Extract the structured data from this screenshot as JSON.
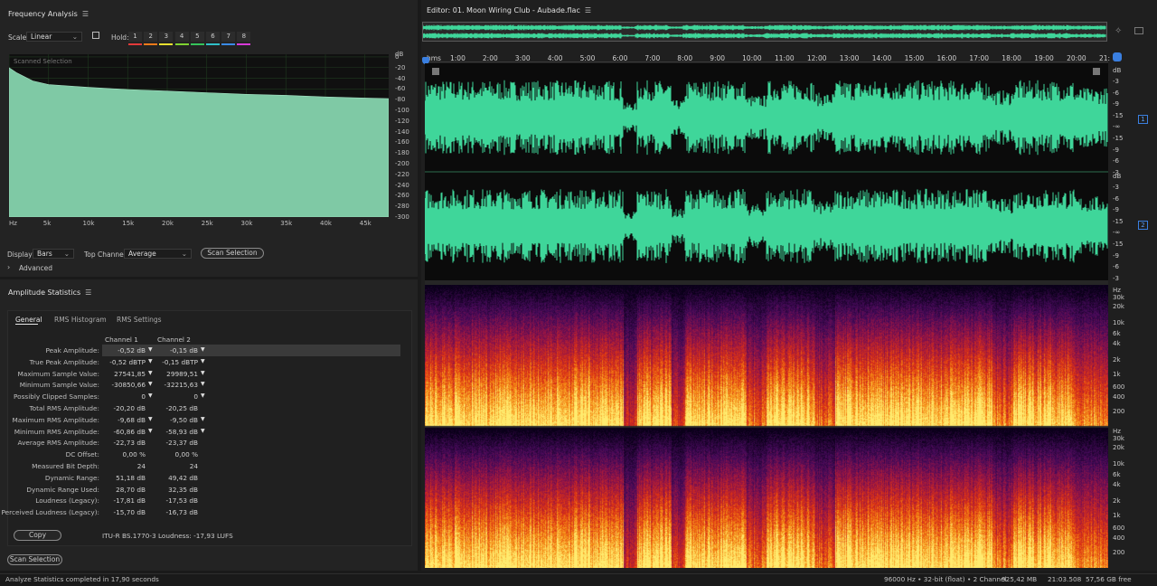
{
  "freq_panel": {
    "title": "Frequency Analysis",
    "scale_label": "Scale:",
    "scale_value": "Linear",
    "hold_label": "Hold:",
    "hold_buttons": [
      {
        "label": "1",
        "color": "#e23a3a"
      },
      {
        "label": "2",
        "color": "#f07a1a"
      },
      {
        "label": "3",
        "color": "#e8e030"
      },
      {
        "label": "4",
        "color": "#7fd431"
      },
      {
        "label": "5",
        "color": "#35c35a"
      },
      {
        "label": "6",
        "color": "#30c0c8"
      },
      {
        "label": "7",
        "color": "#3a8ae6"
      },
      {
        "label": "8",
        "color": "#d83ad8"
      }
    ],
    "graph_caption": "Scanned Selection",
    "y_unit": "dB",
    "y_ticks": [
      "0",
      "-20",
      "-40",
      "-60",
      "-80",
      "-100",
      "-120",
      "-140",
      "-160",
      "-180",
      "-200",
      "-220",
      "-240",
      "-260",
      "-280",
      "-300"
    ],
    "x_ticks": [
      "Hz",
      "5k",
      "10k",
      "15k",
      "20k",
      "25k",
      "30k",
      "35k",
      "40k",
      "45k"
    ],
    "display_label": "Display:",
    "display_value": "Bars",
    "top_channel_label": "Top Channel:",
    "top_channel_value": "Average",
    "scan_button": "Scan Selection",
    "advanced_label": "Advanced"
  },
  "chart_data": {
    "type": "area",
    "x": [
      0,
      1000,
      3000,
      5000,
      10000,
      15000,
      20000,
      25000,
      30000,
      35000,
      40000,
      45000,
      48000
    ],
    "values": [
      -20,
      -30,
      -45,
      -52,
      -57,
      -61,
      -64,
      -67,
      -70,
      -72,
      -75,
      -77,
      -78
    ],
    "xlabel": "Hz",
    "ylabel": "dB",
    "xlim": [
      0,
      48000
    ],
    "ylim": [
      -300,
      5
    ],
    "grid": true,
    "color": "#7fc9a5"
  },
  "amp_panel": {
    "title": "Amplitude Statistics",
    "tabs": [
      "General",
      "RMS Histogram",
      "RMS Settings"
    ],
    "col_headers": [
      "Channel 1",
      "Channel 2"
    ],
    "rows": [
      {
        "label": "Peak Amplitude:",
        "c1": "-0,52 dB",
        "c2": "-0,15 dB",
        "marker": true
      },
      {
        "label": "True Peak Amplitude:",
        "c1": "-0,52 dBTP",
        "c2": "-0,15 dBTP",
        "marker": true
      },
      {
        "label": "Maximum Sample Value:",
        "c1": "27541,85",
        "c2": "29989,51",
        "marker": true
      },
      {
        "label": "Minimum Sample Value:",
        "c1": "-30850,66",
        "c2": "-32215,63",
        "marker": true
      },
      {
        "label": "Possibly Clipped Samples:",
        "c1": "0",
        "c2": "0",
        "marker": true
      },
      {
        "label": "Total RMS Amplitude:",
        "c1": "-20,20 dB",
        "c2": "-20,25 dB",
        "marker": false
      },
      {
        "label": "Maximum RMS Amplitude:",
        "c1": "-9,68 dB",
        "c2": "-9,50 dB",
        "marker": true
      },
      {
        "label": "Minimum RMS Amplitude:",
        "c1": "-60,86 dB",
        "c2": "-58,93 dB",
        "marker": true
      },
      {
        "label": "Average RMS Amplitude:",
        "c1": "-22,73 dB",
        "c2": "-23,37 dB",
        "marker": false
      },
      {
        "label": "DC Offset:",
        "c1": "0,00 %",
        "c2": "0,00 %",
        "marker": false
      },
      {
        "label": "Measured Bit Depth:",
        "c1": "24",
        "c2": "24",
        "marker": false
      },
      {
        "label": "Dynamic Range:",
        "c1": "51,18 dB",
        "c2": "49,42 dB",
        "marker": false
      },
      {
        "label": "Dynamic Range Used:",
        "c1": "28,70 dB",
        "c2": "32,35 dB",
        "marker": false
      },
      {
        "label": "Loudness (Legacy):",
        "c1": "-17,81 dB",
        "c2": "-17,53 dB",
        "marker": false
      },
      {
        "label": "Perceived Loudness (Legacy):",
        "c1": "-15,70 dB",
        "c2": "-16,73 dB",
        "marker": false
      }
    ],
    "copy_button": "Copy",
    "loudness_text": "ITU-R BS.1770-3 Loudness: -17,93 LUFS",
    "scan_button": "Scan Selection"
  },
  "editor": {
    "title": "Editor: 01. Moon Wiring Club - Aubade.flac",
    "ruler": [
      "hms",
      "1:00",
      "2:00",
      "3:00",
      "4:00",
      "5:00",
      "6:00",
      "7:00",
      "8:00",
      "9:00",
      "10:00",
      "11:00",
      "12:00",
      "13:00",
      "14:00",
      "15:00",
      "16:00",
      "17:00",
      "18:00",
      "19:00",
      "20:00",
      "21:"
    ],
    "db_unit": "dB",
    "db_ticks": [
      "-3",
      "-6",
      "-9",
      "-15",
      "-∞",
      "-15",
      "-9",
      "-6",
      "-3"
    ],
    "channel_badges": [
      "1",
      "2"
    ],
    "hz_unit": "Hz",
    "hz_ticks": [
      "30k",
      "20k",
      "10k",
      "6k",
      "4k",
      "2k",
      "1k",
      "600",
      "400",
      "200"
    ],
    "wave_color": "#3fd69a"
  },
  "status_bar": {
    "message": "Analyze Statistics completed in 17,90 seconds",
    "sample_info": "96000 Hz • 32-bit (float) • 2 Channel",
    "size": "925,42 MB",
    "duration": "21:03.508",
    "free": "57,56 GB free"
  }
}
